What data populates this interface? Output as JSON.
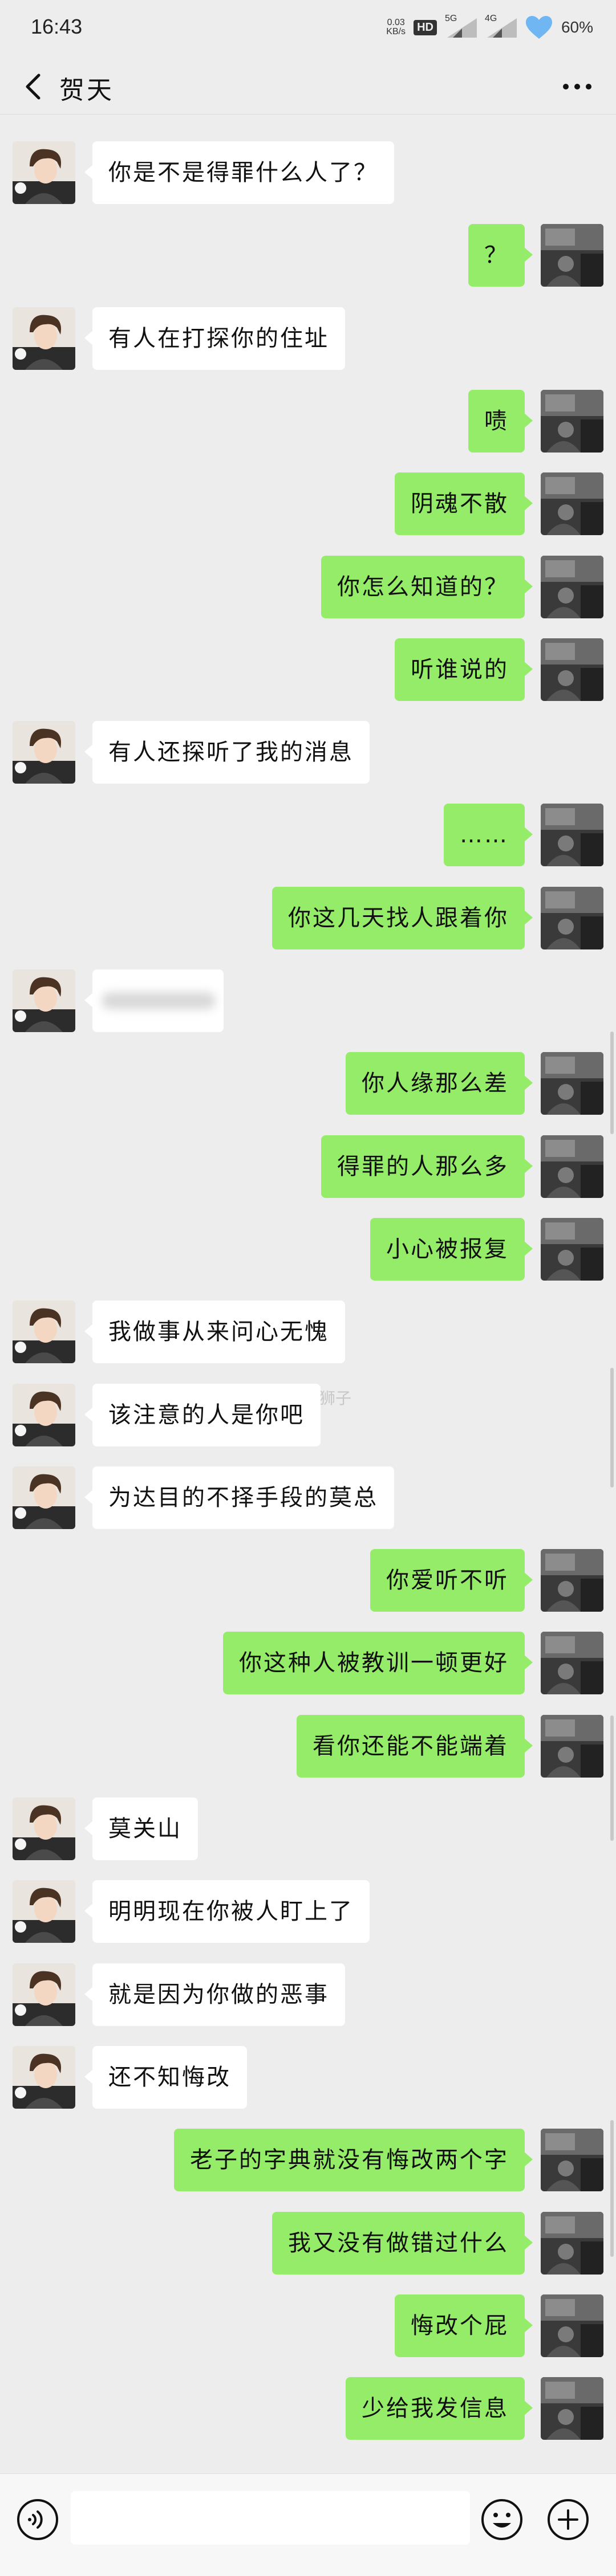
{
  "status_bar": {
    "time": "16:43",
    "net_speed_value": "0.03",
    "net_speed_unit": "KB/s",
    "hd_badge": "HD",
    "signal_1_label": "5G",
    "signal_2_label": "4G",
    "battery": "60%"
  },
  "header": {
    "title": "贺天"
  },
  "watermark": "@听说那个狮子",
  "messages": [
    {
      "side": "in",
      "text": "你是不是得罪什么人了？"
    },
    {
      "side": "out",
      "text": "？"
    },
    {
      "side": "in",
      "text": "有人在打探你的住址"
    },
    {
      "side": "out",
      "text": "啧"
    },
    {
      "side": "out",
      "text": "阴魂不散"
    },
    {
      "side": "out",
      "text": "你怎么知道的？"
    },
    {
      "side": "out",
      "text": "听谁说的"
    },
    {
      "side": "in",
      "text": "有人还探听了我的消息"
    },
    {
      "side": "out",
      "text": "……"
    },
    {
      "side": "out",
      "text": "你这几天找人跟着你"
    },
    {
      "side": "in",
      "text": ""
    },
    {
      "side": "out",
      "text": "你人缘那么差"
    },
    {
      "side": "out",
      "text": "得罪的人那么多"
    },
    {
      "side": "out",
      "text": "小心被报复"
    },
    {
      "side": "in",
      "text": "我做事从来问心无愧"
    },
    {
      "side": "in",
      "text": "该注意的人是你吧"
    },
    {
      "side": "in",
      "text": "为达目的不择手段的莫总"
    },
    {
      "side": "out",
      "text": "你爱听不听"
    },
    {
      "side": "out",
      "text": "你这种人被教训一顿更好"
    },
    {
      "side": "out",
      "text": "看你还能不能端着"
    },
    {
      "side": "in",
      "text": "莫关山"
    },
    {
      "side": "in",
      "text": "明明现在你被人盯上了"
    },
    {
      "side": "in",
      "text": "就是因为你做的恶事"
    },
    {
      "side": "in",
      "text": "还不知悔改"
    },
    {
      "side": "out",
      "text": "老子的字典就没有悔改两个字"
    },
    {
      "side": "out",
      "text": "我又没有做错过什么"
    },
    {
      "side": "out",
      "text": "悔改个屁"
    },
    {
      "side": "out",
      "text": "少给我发信息"
    }
  ],
  "input": {
    "placeholder": ""
  }
}
